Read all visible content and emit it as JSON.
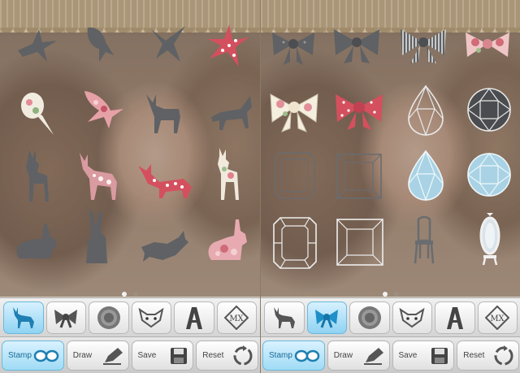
{
  "app": {
    "tabs": [
      {
        "name": "deer",
        "icon": "deer-icon"
      },
      {
        "name": "ribbon",
        "icon": "ribbon-icon"
      },
      {
        "name": "doily",
        "icon": "doily-icon"
      },
      {
        "name": "animal-face",
        "icon": "cat-face-icon"
      },
      {
        "name": "letter",
        "icon": "letter-a-icon"
      },
      {
        "name": "mx",
        "icon": "mx-icon"
      }
    ],
    "actions": [
      {
        "label": "Stamp",
        "icon": "glasses-icon"
      },
      {
        "label": "Draw",
        "icon": "pen-icon"
      },
      {
        "label": "Save",
        "icon": "floppy-icon"
      },
      {
        "label": "Reset",
        "icon": "reset-icon"
      }
    ]
  },
  "screens": [
    {
      "active_tab": 0,
      "active_action": 0,
      "page": 1,
      "pages": 2,
      "stamps": [
        "swallow-icon",
        "swallow-icon",
        "swallow-icon",
        "swallow-floral-icon",
        "bird-floral-icon",
        "swallow-floral-icon",
        "deer-icon",
        "deer-icon",
        "deer-icon",
        "deer-floral-icon",
        "deer-floral-icon",
        "deer-floral-icon",
        "rabbit-icon",
        "rabbit-icon",
        "rabbit-icon",
        "rabbit-floral-icon"
      ]
    },
    {
      "active_tab": 1,
      "active_action": 0,
      "page": 1,
      "pages": 2,
      "stamps": [
        "bow-icon",
        "bow-icon",
        "bow-striped-icon",
        "bow-floral-icon",
        "bow-floral-icon",
        "bow-dotted-icon",
        "gem-drop-icon",
        "gem-round-icon",
        "gem-rect-icon",
        "gem-square-icon",
        "gem-drop-blue-icon",
        "gem-round-blue-icon",
        "gem-rect-icon",
        "gem-square-icon",
        "chair-icon",
        "mirror-icon"
      ]
    }
  ],
  "colors": {
    "accent": "#8fd3f2",
    "floral_pink": "#e06a7a",
    "silhouette": "#5f6164",
    "gem_blue": "#a9d3e4"
  }
}
